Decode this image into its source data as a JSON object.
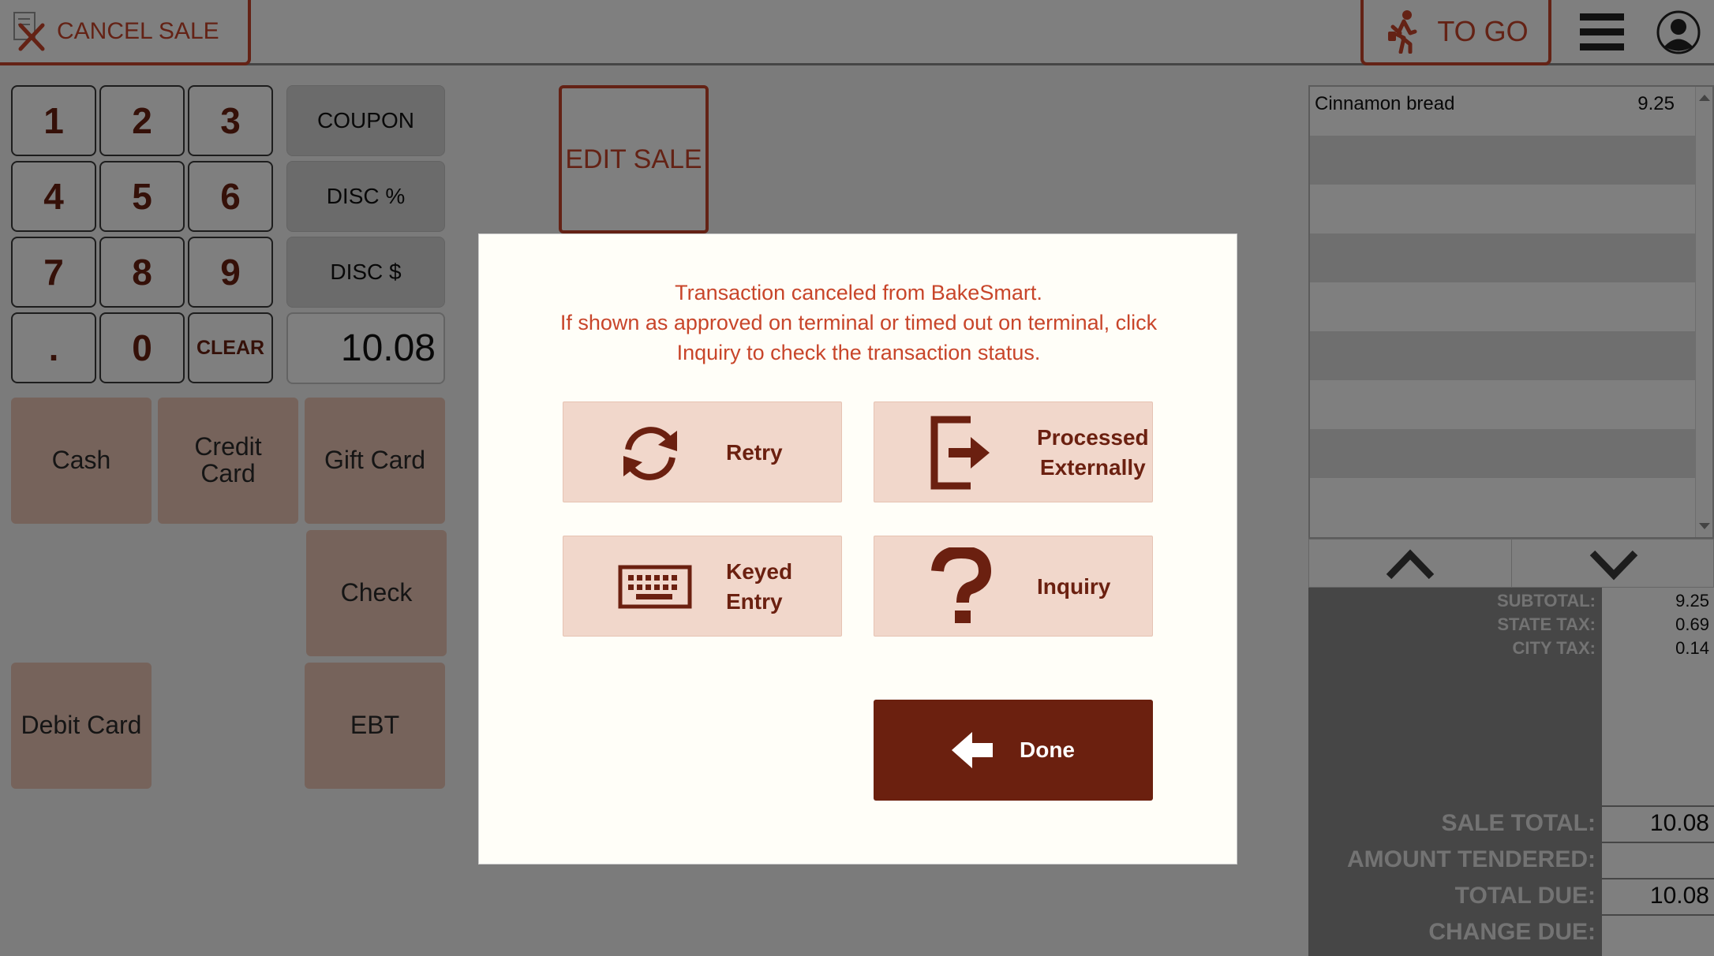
{
  "topbar": {
    "cancel_label": "CANCEL SALE",
    "togo_label": "TO GO"
  },
  "keypad": {
    "keys": [
      "1",
      "2",
      "3",
      "4",
      "5",
      "6",
      "7",
      "8",
      "9",
      ".",
      "0",
      "CLEAR"
    ],
    "coupon": "COUPON",
    "disc_percent": "DISC %",
    "disc_amount": "DISC $",
    "amount": "10.08"
  },
  "tenders": {
    "cash": "Cash",
    "credit_line1": "Credit",
    "credit_line2": "Card",
    "gift": "Gift Card",
    "check": "Check",
    "debit": "Debit Card",
    "ebt": "EBT"
  },
  "edit_sale": "EDIT SALE",
  "receipt": {
    "items": [
      {
        "name": "Cinnamon bread",
        "price": "9.25"
      }
    ],
    "subtotal_label": "SUBTOTAL:",
    "subtotal": "9.25",
    "state_tax_label": "STATE TAX:",
    "state_tax": "0.69",
    "city_tax_label": "CITY TAX:",
    "city_tax": "0.14",
    "sale_total_label": "SALE TOTAL:",
    "sale_total": "10.08",
    "amount_tendered_label": "AMOUNT TENDERED:",
    "amount_tendered": "",
    "total_due_label": "TOTAL DUE:",
    "total_due": "10.08",
    "change_due_label": "CHANGE DUE:",
    "change_due": ""
  },
  "modal": {
    "line1": "Transaction canceled from BakeSmart.",
    "line2": "If shown as approved on terminal or timed out on terminal, click",
    "line3": "Inquiry to check the transaction status.",
    "retry": "Retry",
    "processed_line1": "Processed",
    "processed_line2": "Externally",
    "keyed_line1": "Keyed",
    "keyed_line2": "Entry",
    "inquiry": "Inquiry",
    "done": "Done"
  },
  "colors": {
    "accent": "#c8452a",
    "dark_brown": "#6b200f",
    "tender_bg": "#ecc7b7",
    "action_bg": "#f1d7cb"
  }
}
